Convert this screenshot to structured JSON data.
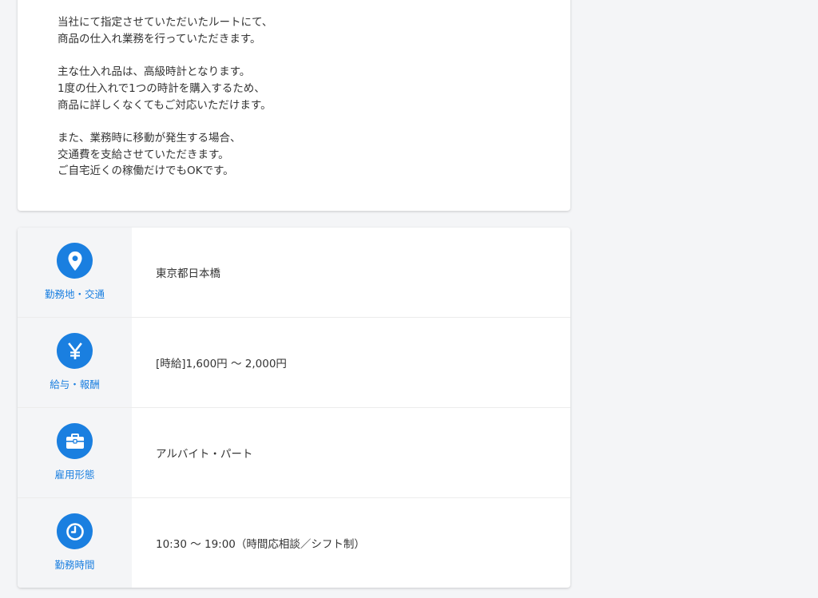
{
  "description": {
    "paragraphs": [
      [
        "当社にて指定させていただいたルートにて、",
        "商品の仕入れ業務を行っていただきます。"
      ],
      [
        "主な仕入れ品は、高級時計となります。",
        "1度の仕入れで1つの時計を購入するため、",
        "商品に詳しくなくてもご対応いただけます。"
      ],
      [
        "また、業務時に移動が発生する場合、",
        "交通費を支給させていただきます。",
        "ご自宅近くの稼働だけでもOKです。"
      ]
    ]
  },
  "info": {
    "rows": [
      {
        "icon": "map-pin-icon",
        "label": "勤務地・交通",
        "value": "東京都日本橋"
      },
      {
        "icon": "yen-icon",
        "label": "給与・報酬",
        "value": "[時給]1,600円 〜 2,000円"
      },
      {
        "icon": "briefcase-icon",
        "label": "雇用形態",
        "value": "アルバイト・パート"
      },
      {
        "icon": "clock-icon",
        "label": "勤務時間",
        "value": "10:30 〜 19:00（時間応相談／シフト制）"
      }
    ]
  },
  "colors": {
    "accent": "#1a7fe0",
    "label_bg": "#f4f5f7",
    "text": "#333333"
  }
}
